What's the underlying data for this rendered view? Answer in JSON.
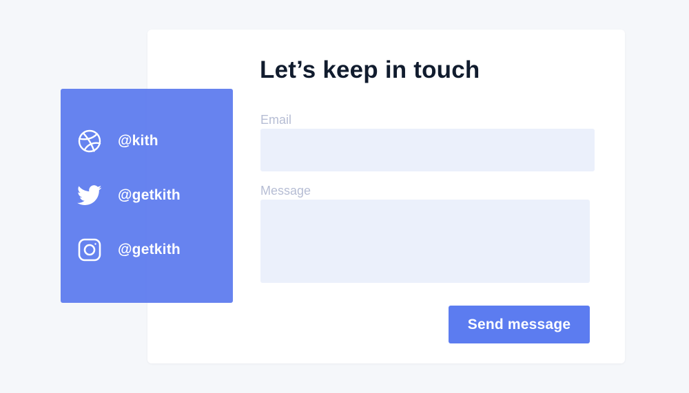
{
  "contact_form": {
    "title": "Let’s keep in touch",
    "email": {
      "label": "Email",
      "value": "",
      "placeholder": ""
    },
    "message": {
      "label": "Message",
      "value": "",
      "placeholder": ""
    },
    "send_button_label": "Send message"
  },
  "social": {
    "items": [
      {
        "icon": "dribbble-icon",
        "handle": "@kith"
      },
      {
        "icon": "twitter-icon",
        "handle": "@getkith"
      },
      {
        "icon": "instagram-icon",
        "handle": "@getkith"
      }
    ]
  },
  "colors": {
    "page_background": "#f5f7fa",
    "card_background": "#ffffff",
    "accent": "#5c7cf0",
    "input_background": "#ebf0fb",
    "label_text": "#b6bdd4",
    "title_text": "#111c2e"
  }
}
